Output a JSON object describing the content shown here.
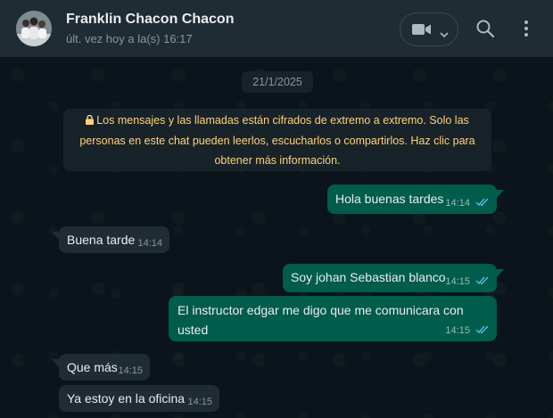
{
  "contact": {
    "name": "Franklin Chacon Chacon",
    "status": "últ. vez hoy a la(s) 16:17"
  },
  "chat": {
    "date_chip": "21/1/2025",
    "encryption_notice": "Los mensajes y las llamadas están cifrados de extremo a extremo. Solo las personas en este chat pueden leerlos, escucharlos o compartirlos. Haz clic para obtener más información.",
    "messages": [
      {
        "direction": "out",
        "text": "Hola buenas tardes",
        "time": "14:14",
        "status": "read"
      },
      {
        "direction": "in",
        "text": "Buena tarde",
        "time": "14:14"
      },
      {
        "direction": "out",
        "text": "Soy johan Sebastian blanco",
        "time": "14:15",
        "status": "read"
      },
      {
        "direction": "out",
        "text": "El instructor edgar me digo que me comunicara con usted",
        "time": "14:15",
        "status": "read"
      },
      {
        "direction": "in",
        "text": "Que más",
        "time": "14:15"
      },
      {
        "direction": "in",
        "text": "Ya estoy en la oficina",
        "time": "14:15"
      }
    ]
  },
  "icons": {
    "video_call": "video-camera-icon",
    "dropdown": "chevron-down-icon",
    "search": "search-icon",
    "menu": "kebab-menu-icon",
    "lock": "lock-icon",
    "read_receipt": "double-check-icon"
  },
  "colors": {
    "outgoing_bubble": "#005c4b",
    "incoming_bubble": "#202c33",
    "read_tick": "#53bdeb",
    "notice_text": "#ffd279"
  }
}
